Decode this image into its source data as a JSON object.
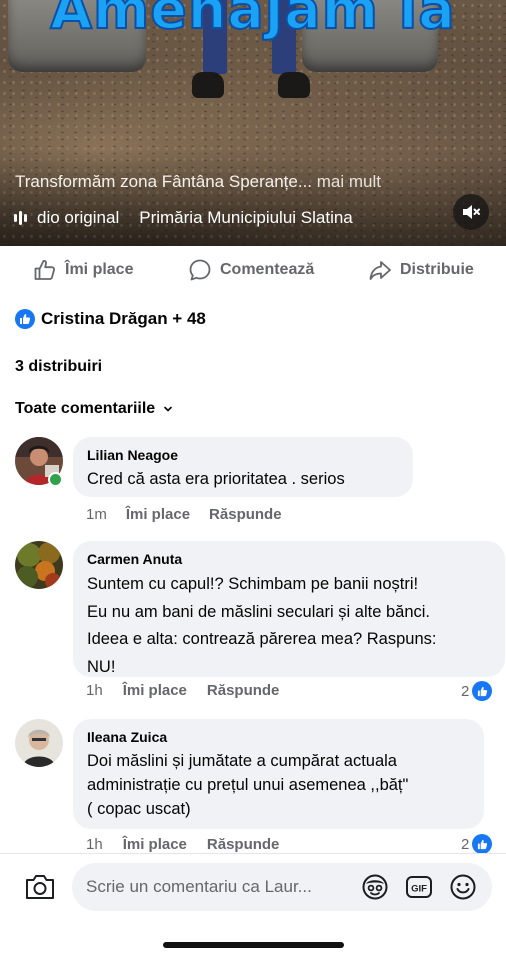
{
  "video": {
    "overlay_text": "Amenajam la",
    "caption": "Transformăm zona Fântâna Speranțe...",
    "caption_more": "mai mult",
    "audio_label": "dio original",
    "audio_source": "Primăria Municipiului Slatina",
    "mute_icon": "speaker-muted-icon"
  },
  "actions": {
    "like": "Îmi place",
    "comment": "Comentează",
    "share": "Distribuie"
  },
  "reactions": {
    "summary": "Cristina Drăgan + 48"
  },
  "shares_count": "3 distribuiri",
  "comments_filter": "Toate comentariile",
  "comments": [
    {
      "author": "Lilian Neagoe",
      "lines": [
        "Cred că asta era prioritatea  . serios"
      ],
      "time": "1m",
      "like_label": "Îmi place",
      "reply_label": "Răspunde",
      "online": true
    },
    {
      "author": "Carmen Anuta",
      "lines": [
        "Suntem cu capul!? Schimbam pe banii noștri!",
        "Eu nu am bani de măslini seculari și alte bănci.",
        "Ideea e alta: contrează părerea mea? Raspuns:",
        "NU!"
      ],
      "time": "1h",
      "like_label": "Îmi place",
      "reply_label": "Răspunde",
      "reactions": "2"
    },
    {
      "author": "Ileana Zuica",
      "lines": [
        "Doi măslini și jumătate a cumpărat actuala",
        "administrație cu prețul unui asemenea ,,băț\"",
        "( copac uscat)"
      ],
      "time": "1h",
      "like_label": "Îmi place",
      "reply_label": "Răspunde",
      "reactions": "2"
    }
  ],
  "composer": {
    "placeholder": "Scrie un comentariu ca Laur...",
    "gif_label": "GIF"
  },
  "colors": {
    "accent": "#1877f2",
    "online": "#31a24c",
    "secondary_text": "#65676b",
    "bubble": "#f0f2f5",
    "overlay_title": "#1aa3f5"
  }
}
